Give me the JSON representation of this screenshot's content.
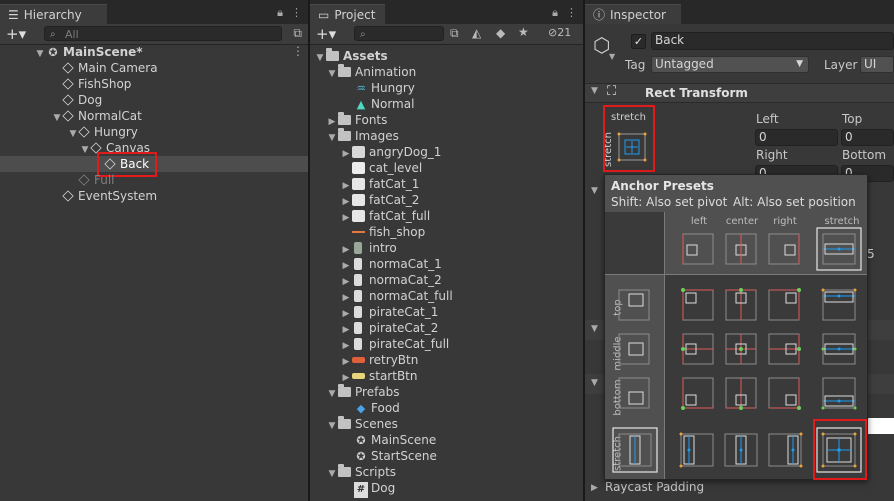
{
  "hierarchy": {
    "tab_label": "Hierarchy",
    "search_placeholder": "All",
    "items": [
      {
        "label": "MainScene*"
      },
      {
        "label": "Main Camera"
      },
      {
        "label": "FishShop"
      },
      {
        "label": "Dog"
      },
      {
        "label": "NormalCat"
      },
      {
        "label": "Hungry"
      },
      {
        "label": "Canvas"
      },
      {
        "label": "Back"
      },
      {
        "label": "Full"
      },
      {
        "label": "EventSystem"
      }
    ]
  },
  "project": {
    "tab_label": "Project",
    "hidden_count": "21",
    "items": [
      {
        "label": "Assets"
      },
      {
        "label": "Animation"
      },
      {
        "label": "Hungry"
      },
      {
        "label": "Normal"
      },
      {
        "label": "Fonts"
      },
      {
        "label": "Images"
      },
      {
        "label": "angryDog_1"
      },
      {
        "label": "cat_level"
      },
      {
        "label": "fatCat_1"
      },
      {
        "label": "fatCat_2"
      },
      {
        "label": "fatCat_full"
      },
      {
        "label": "fish_shop"
      },
      {
        "label": "intro"
      },
      {
        "label": "normaCat_1"
      },
      {
        "label": "normaCat_2"
      },
      {
        "label": "normaCat_full"
      },
      {
        "label": "pirateCat_1"
      },
      {
        "label": "pirateCat_2"
      },
      {
        "label": "pirateCat_full"
      },
      {
        "label": "retryBtn"
      },
      {
        "label": "startBtn"
      },
      {
        "label": "Prefabs"
      },
      {
        "label": "Food"
      },
      {
        "label": "Scenes"
      },
      {
        "label": "MainScene"
      },
      {
        "label": "StartScene"
      },
      {
        "label": "Scripts"
      },
      {
        "label": "Dog"
      }
    ]
  },
  "inspector": {
    "tab_label": "Inspector",
    "object_name": "Back",
    "tag_label": "Tag",
    "tag_value": "Untagged",
    "layer_label": "Layer",
    "layer_value": "UI",
    "component_title": "Rect Transform",
    "anchor_label_top": "stretch",
    "anchor_label_side": "stretch",
    "fields": {
      "left_label": "Left",
      "left_value": "0",
      "top_label": "Top",
      "top_value": "0",
      "right_label": "Right",
      "right_value": "0",
      "bottom_label": "Bottom",
      "bottom_value": "0"
    },
    "partial_value": "5",
    "footer_label": "Raycast Padding",
    "popup": {
      "title": "Anchor Presets",
      "hint_shift": "Shift: Also set pivot",
      "hint_alt": "Alt: Also set position",
      "col_headers": [
        "left",
        "center",
        "right",
        "stretch"
      ],
      "row_headers": [
        "top",
        "middle",
        "bottom",
        "stretch"
      ]
    }
  },
  "colors": {
    "selection_outline": "#e11b1b",
    "anchor_blue": "#1f9cf0",
    "anchor_green": "#6ecf5a",
    "anchor_orange": "#e8a23c"
  }
}
